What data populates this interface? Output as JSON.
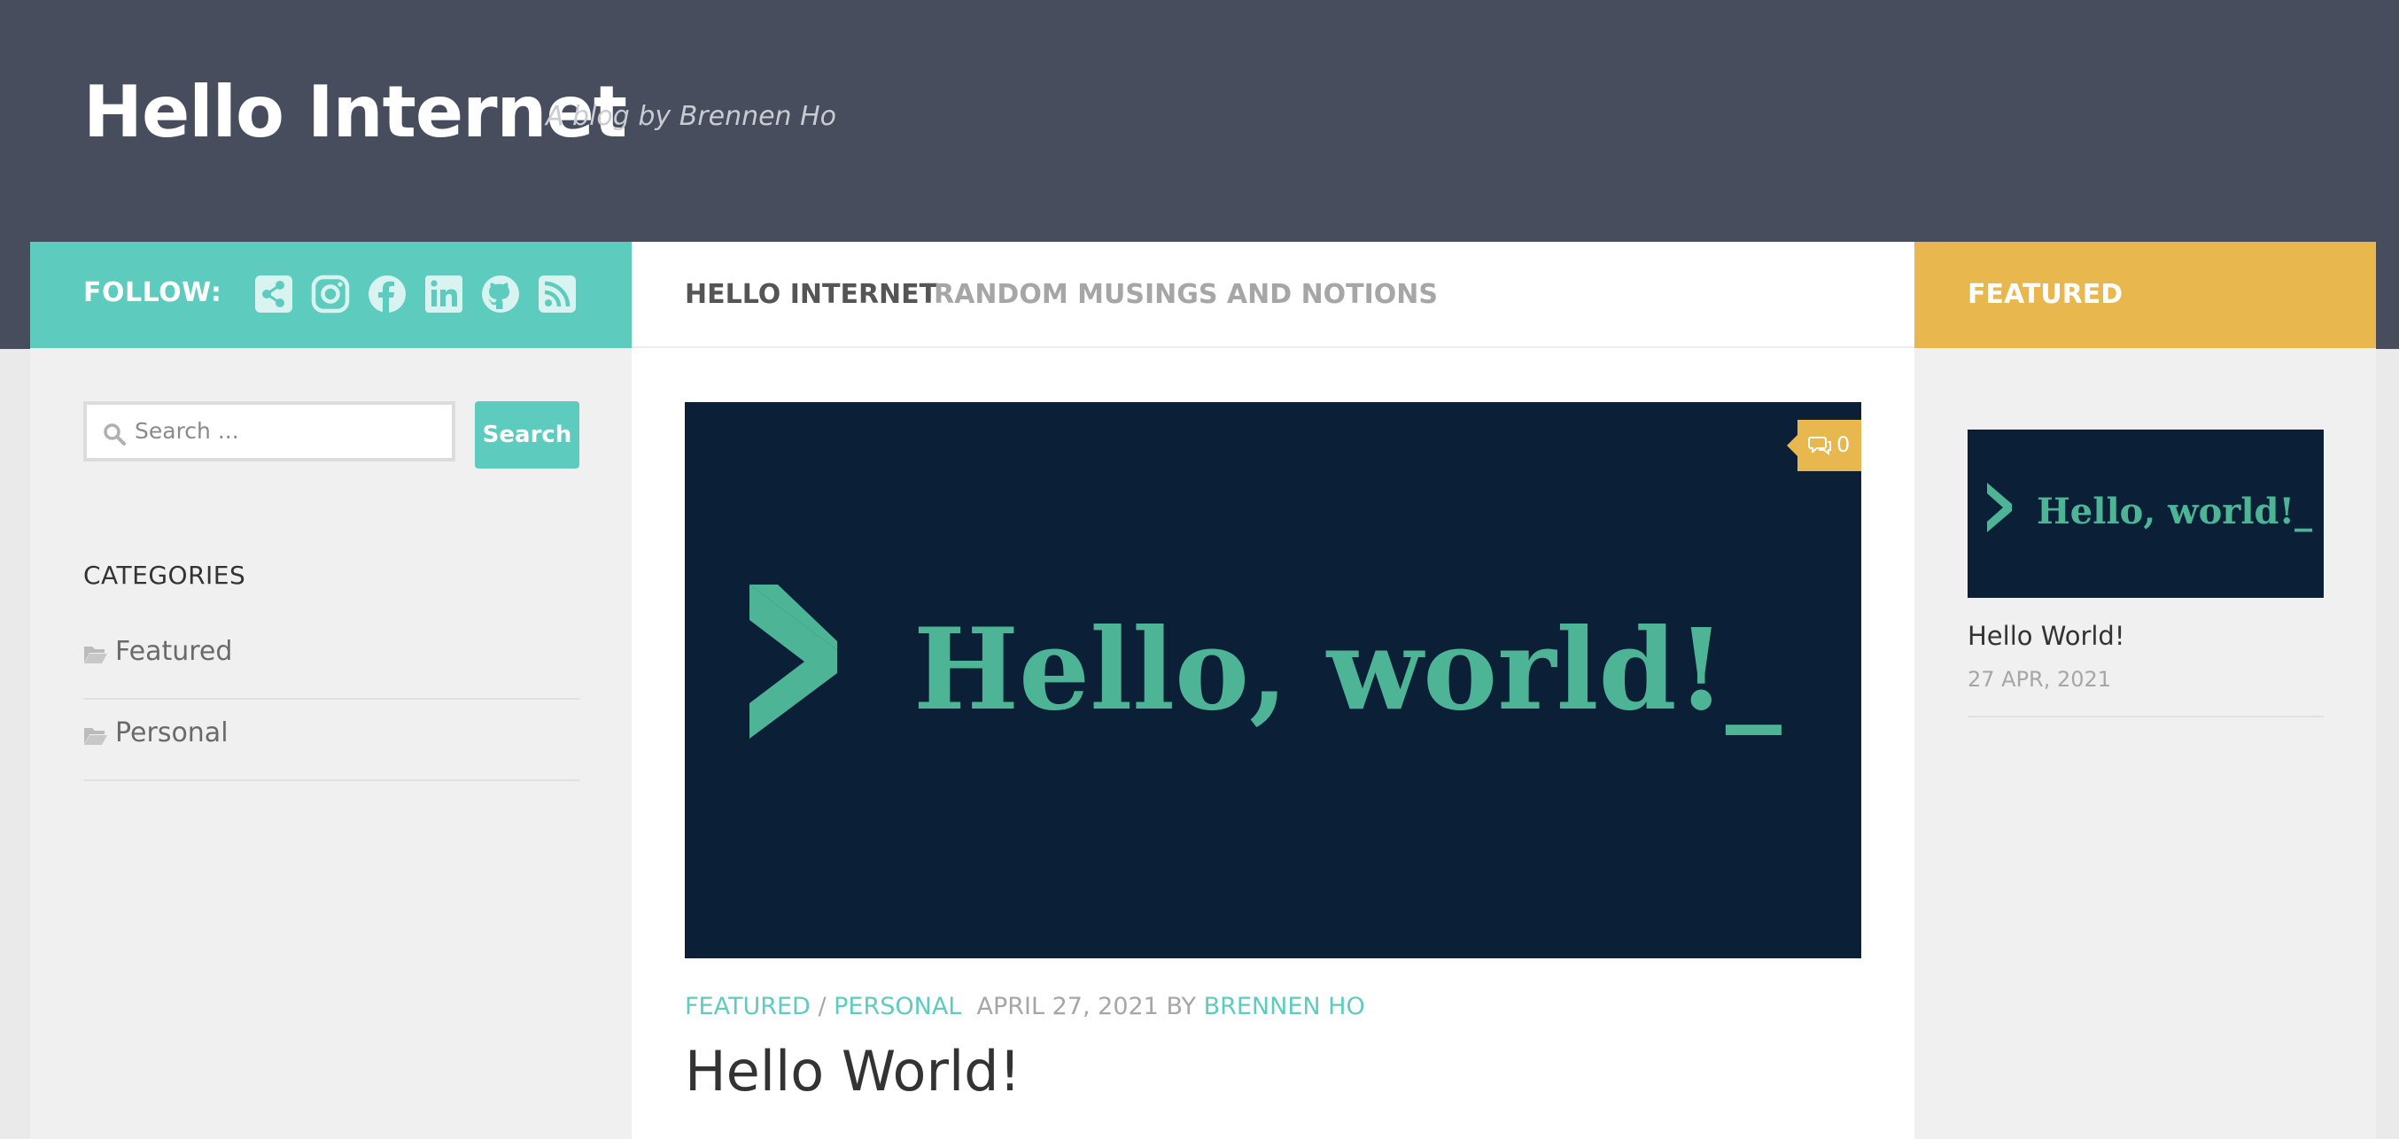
{
  "site": {
    "title": "Hello Internet",
    "tagline": "A blog by Brennen Ho"
  },
  "follow": {
    "label": "FOLLOW:",
    "icons": [
      "share-icon",
      "instagram-icon",
      "facebook-icon",
      "linkedin-icon",
      "github-icon",
      "rss-icon"
    ]
  },
  "search": {
    "placeholder": "Search ...",
    "button_label": "Search"
  },
  "categories": {
    "heading": "CATEGORIES",
    "items": [
      {
        "label": "Featured"
      },
      {
        "label": "Personal"
      }
    ]
  },
  "page_header": {
    "title": "HELLO INTERNET",
    "subtitle": "RANDOM MUSINGS AND NOTIONS"
  },
  "post": {
    "image_text": "Hello, world!_",
    "comment_count": "0",
    "category_1": "FEATURED",
    "separator": "/",
    "category_2": "PERSONAL",
    "date": "APRIL 27, 2021",
    "by": "BY",
    "author": "BRENNEN HO",
    "title": "Hello World!"
  },
  "featured": {
    "heading": "FEATURED",
    "image_text": "Hello, world!_",
    "title": "Hello World!",
    "date": "27 APR, 2021"
  },
  "colors": {
    "header_bg": "#474d5c",
    "teal": "#5ecbbf",
    "yellow": "#e8b74e",
    "image_bg": "#0b1f37",
    "image_green": "#4db596"
  }
}
